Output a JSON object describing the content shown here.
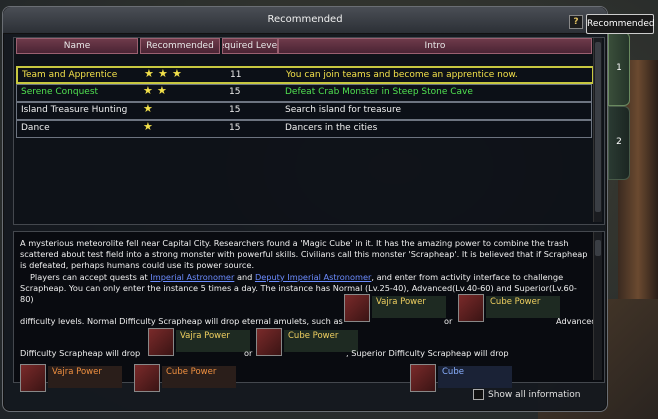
{
  "window": {
    "title": "Recommended",
    "help_label": "?"
  },
  "tooltip": "Recommended",
  "table": {
    "headers": [
      "Name",
      "Recommended",
      "Required Level",
      "Intro"
    ],
    "rows": [
      {
        "name": "Team and Apprentice",
        "stars": 3,
        "level": "11",
        "intro": "You can join teams and become an apprentice now.",
        "color": "#f2e04a",
        "selected": true
      },
      {
        "name": "Serene Conquest",
        "stars": 2,
        "level": "15",
        "intro": "Defeat Crab Monster in Steep Stone Cave",
        "color": "#50e050",
        "selected": false
      },
      {
        "name": "Island Treasure Hunting",
        "stars": 1,
        "level": "15",
        "intro": "Search island for treasure",
        "color": "#f0f0f0",
        "selected": false
      },
      {
        "name": "Dance",
        "stars": 1,
        "level": "15",
        "intro": "Dancers in the cities",
        "color": "#f0f0f0",
        "selected": false
      }
    ]
  },
  "tabs": [
    "1",
    "2"
  ],
  "description": {
    "para1": "A mysterious meteorolite fell near Capital City. Researchers found a 'Magic Cube' in it. It has the amazing power to combine the trash scattered about test field into a strong monster with powerful skills. Civilians call this monster 'Scrapheap'. It is believed that if Scrapheap is defeated, perhaps humans could use its power source.",
    "para2_a": "Players can accept quests at ",
    "link1": "Imperial Astronomer",
    "para2_b": " and ",
    "link2": "Deputy Imperial Astronomer",
    "para2_c": ", and enter from activity interface to challenge Scrapheap. You can only enter the instance 5 times a day. The instance has Normal (Lv.25-40), Advanced(Lv.40-60) and Superior(Lv.60-80)",
    "line_difficulty": "difficulty levels. Normal Difficulty Scrapheap will drop eternal amulets, such as",
    "word_or1": "or",
    "word_advanced": "Advanced",
    "line_adv": "Difficulty Scrapheap will drop",
    "word_or2": "or",
    "line_sup": ", Superior Difficulty Scrapheap will drop",
    "items": {
      "vajra1": "Vajra Power",
      "cube1": "Cube Power",
      "vajra2": "Vajra Power",
      "cube2": "Cube Power",
      "vajra3": "Vajra Power",
      "cube3": "Cube Power",
      "cube4": "Cube"
    }
  },
  "footer": {
    "show_all": "Show all information"
  }
}
